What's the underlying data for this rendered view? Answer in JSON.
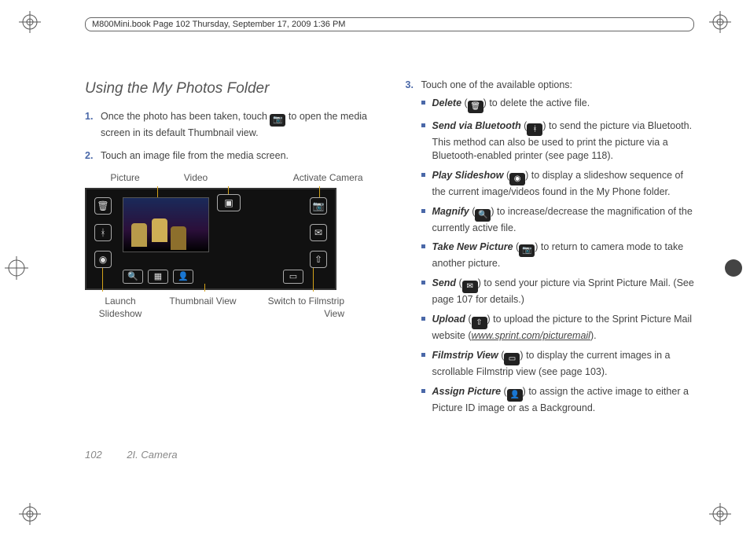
{
  "header": {
    "text": "M800Mini.book  Page 102  Thursday, September 17, 2009  1:36 PM"
  },
  "title": "Using the My Photos Folder",
  "left": {
    "step1_a": "Once the photo has been taken, touch ",
    "step1_b": " to open the media screen in its default Thumbnail view.",
    "step2": "Touch an image file from the media screen.",
    "labels_top": {
      "picture": "Picture",
      "video": "Video",
      "camera": "Activate Camera"
    },
    "labels_bottom": {
      "slideshow": "Launch Slideshow",
      "thumb": "Thumbnail View",
      "filmstrip": "Switch to Filmstrip View"
    }
  },
  "right": {
    "step3": "Touch one of the available options:",
    "options": {
      "delete": {
        "name": "Delete",
        "after": " to delete the active file."
      },
      "bluetooth": {
        "name": "Send via Bluetooth",
        "after": " to send the picture via Bluetooth. This method can also be used to print the picture via a Bluetooth-enabled printer (see page 118)."
      },
      "slideshow": {
        "name": "Play Slideshow",
        "after": " to display a slideshow sequence of the current image/videos found in the My Phone folder."
      },
      "magnify": {
        "name": "Magnify",
        "after": " to increase/decrease the magnification of the currently active file."
      },
      "newpic": {
        "name": "Take New Picture",
        "after": " to return to camera mode to take another picture."
      },
      "send": {
        "name": "Send",
        "after": " to send your picture via Sprint Picture Mail. (See page 107 for details.)"
      },
      "upload": {
        "name": "Upload",
        "after_a": " to upload the picture to the Sprint Picture Mail website (",
        "url": "www.sprint.com/picturemail",
        "after_b": ")."
      },
      "filmstrip": {
        "name": "Filmstrip View",
        "after": " to display the current images in a scrollable Filmstrip view (see page 103)."
      },
      "assign": {
        "name": "Assign Picture",
        "after": " to assign the active image to either a Picture ID image or as a Background."
      }
    }
  },
  "footer": {
    "page": "102",
    "section": "2I. Camera"
  },
  "paren_open": " (",
  "paren_close": ") "
}
